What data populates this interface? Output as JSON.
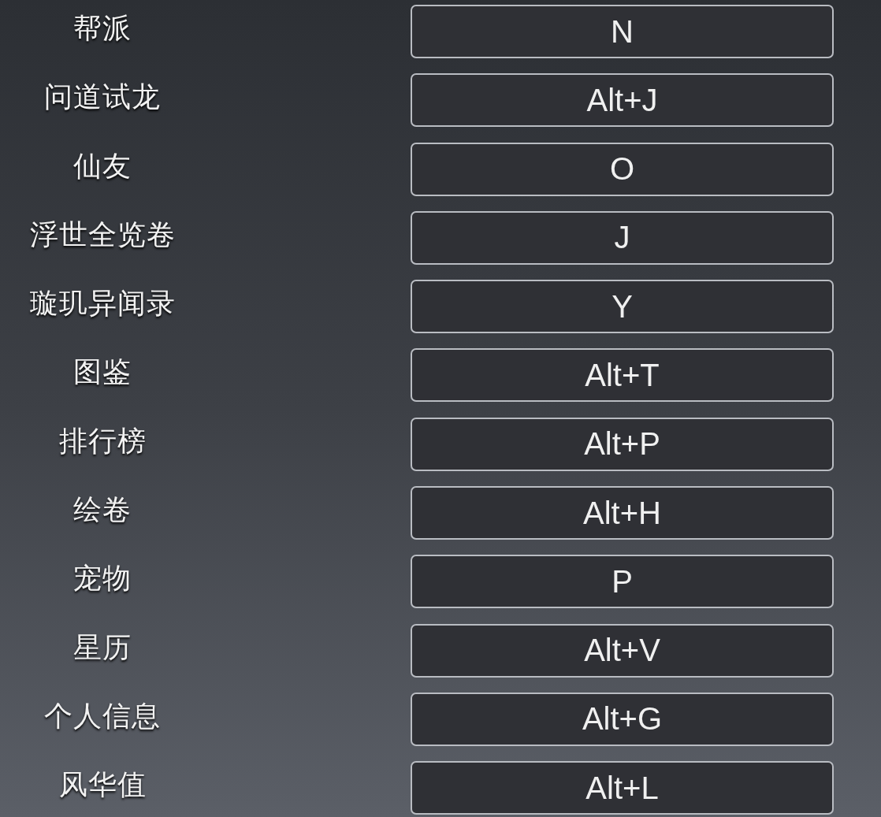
{
  "bindings": [
    {
      "action": "帮派",
      "key": "N"
    },
    {
      "action": "问道试龙",
      "key": "Alt+J"
    },
    {
      "action": "仙友",
      "key": "O"
    },
    {
      "action": "浮世全览卷",
      "key": "J"
    },
    {
      "action": "璇玑异闻录",
      "key": "Y"
    },
    {
      "action": "图鉴",
      "key": "Alt+T"
    },
    {
      "action": "排行榜",
      "key": "Alt+P"
    },
    {
      "action": "绘卷",
      "key": "Alt+H"
    },
    {
      "action": "宠物",
      "key": "P"
    },
    {
      "action": "星历",
      "key": "Alt+V"
    },
    {
      "action": "个人信息",
      "key": "Alt+G"
    },
    {
      "action": "风华值",
      "key": "Alt+L"
    }
  ]
}
